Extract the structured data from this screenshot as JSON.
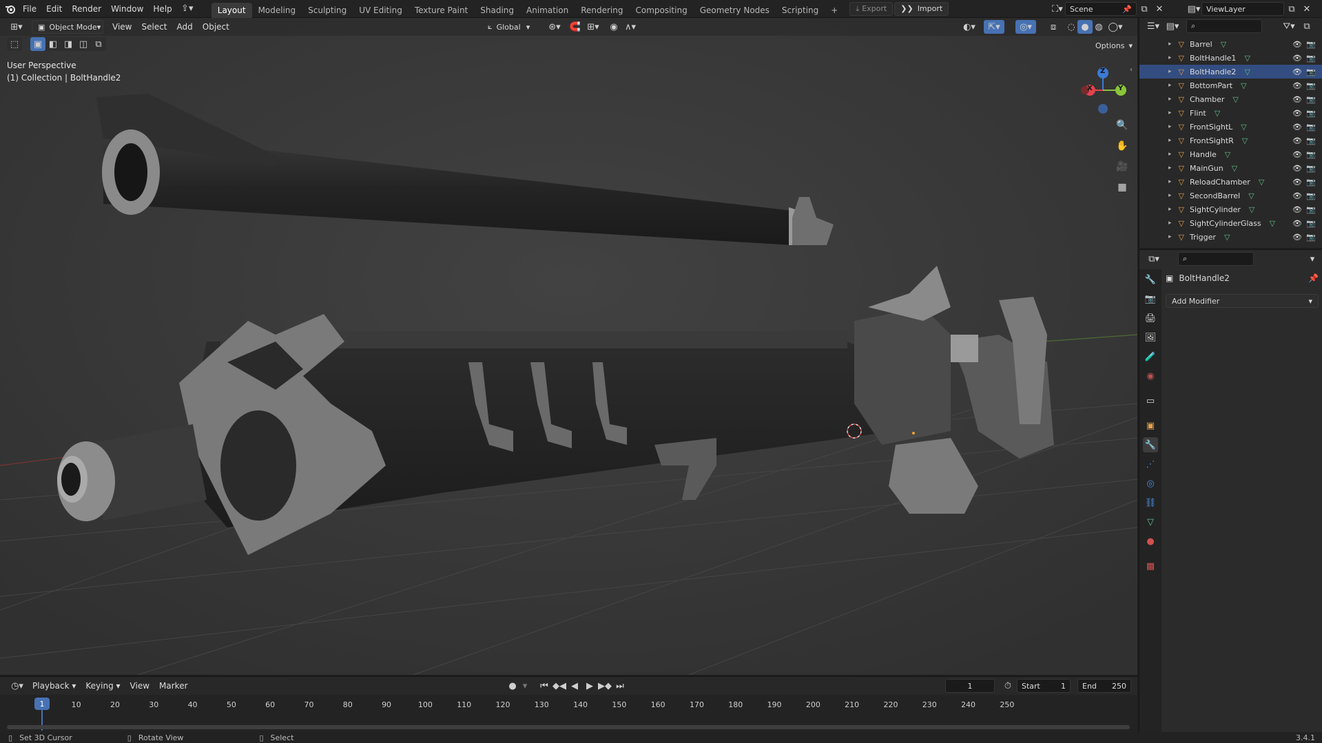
{
  "topbar": {
    "menus": [
      "File",
      "Edit",
      "Render",
      "Window",
      "Help"
    ],
    "workspaces": [
      "Layout",
      "Modeling",
      "Sculpting",
      "UV Editing",
      "Texture Paint",
      "Shading",
      "Animation",
      "Rendering",
      "Compositing",
      "Geometry Nodes",
      "Scripting"
    ],
    "active_workspace": "Layout",
    "add_workspace": "+",
    "export_label": "Export",
    "import_label": "Import",
    "scene": "Scene",
    "view_layer": "ViewLayer"
  },
  "viewport": {
    "mode": "Object Mode",
    "menus": [
      "View",
      "Select",
      "Add",
      "Object"
    ],
    "orientation": "Global",
    "options_label": "Options",
    "info_line1": "User Perspective",
    "info_line2": "(1) Collection | BoltHandle2",
    "gizmo_axes": {
      "x": "X",
      "y": "Y",
      "z": "Z"
    }
  },
  "outliner": {
    "items": [
      "Barrel",
      "BoltHandle1",
      "BoltHandle2",
      "BottomPart",
      "Chamber",
      "Flint",
      "FrontSightL",
      "FrontSightR",
      "Handle",
      "MainGun",
      "ReloadChamber",
      "SecondBarrel",
      "SightCylinder",
      "SightCylinderGlass",
      "Trigger"
    ],
    "selected": "BoltHandle2"
  },
  "properties": {
    "object_name": "BoltHandle2",
    "add_modifier_label": "Add Modifier"
  },
  "timeline": {
    "menus": [
      "Playback",
      "Keying",
      "View",
      "Marker"
    ],
    "current_frame": "1",
    "start_label": "Start",
    "start_value": "1",
    "end_label": "End",
    "end_value": "250",
    "ticks": [
      "1",
      "10",
      "20",
      "30",
      "40",
      "50",
      "60",
      "70",
      "80",
      "90",
      "100",
      "110",
      "120",
      "130",
      "140",
      "150",
      "160",
      "170",
      "180",
      "190",
      "200",
      "210",
      "220",
      "230",
      "240",
      "250"
    ]
  },
  "statusbar": {
    "hint1": "Set 3D Cursor",
    "hint2": "Rotate View",
    "hint3": "Select",
    "version": "3.4.1"
  },
  "colors": {
    "accent": "#4772b3",
    "axis_x": "#e3424f",
    "axis_y": "#8bc43b",
    "axis_z": "#3b7ad6",
    "mesh_icon": "#e8a04a",
    "vertex_icon": "#5fbf88"
  }
}
